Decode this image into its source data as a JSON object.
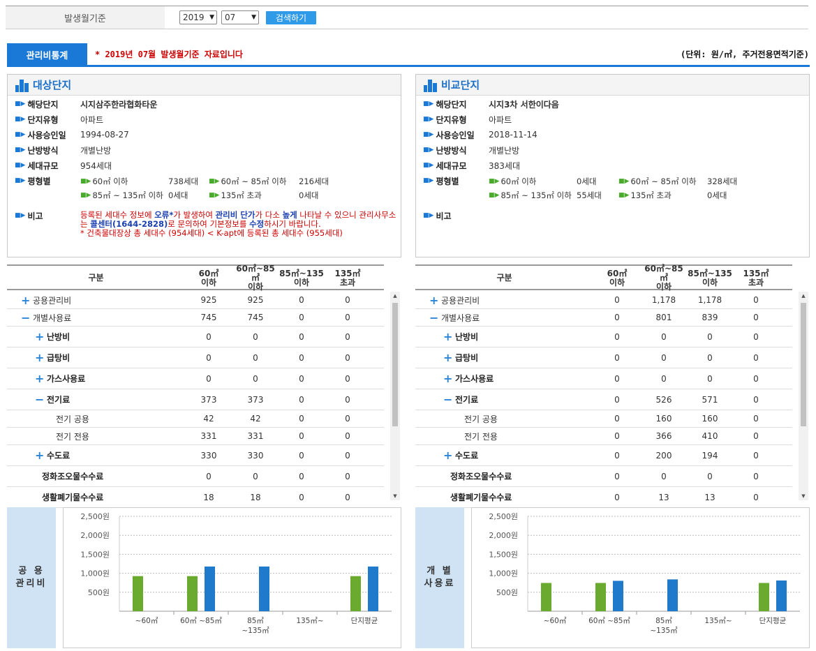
{
  "filter": {
    "label": "발생월기준",
    "year": "2019",
    "month": "07",
    "search_label": "검색하기"
  },
  "tab_label": "관리비통계",
  "notice": "* 2019년 07월 발생월기준 자료입니다",
  "unit_note": "(단위: 원/㎡, 주거전용면적기준)",
  "target": {
    "title": "대상단지",
    "labels": {
      "name": "해당단지",
      "type": "단지유형",
      "approval": "사용승인일",
      "heating": "난방방식",
      "scale": "세대규모",
      "size": "평형별",
      "remark": "비고"
    },
    "name": "시지삼주한라협화타운",
    "type": "아파트",
    "approval": "1994-08-27",
    "heating": "개별난방",
    "scale": "954세대",
    "sizes": [
      {
        "label": "60㎡ 이하",
        "count": "738세대"
      },
      {
        "label": "60㎡ ~ 85㎡ 이하",
        "count": "216세대"
      },
      {
        "label": "85㎡ ~ 135㎡ 이하",
        "count": "0세대"
      },
      {
        "label": "135㎡ 초과",
        "count": "0세대"
      }
    ],
    "remark": {
      "p1": "등록된 세대수 정보에 ",
      "p2": "오류*",
      "p3": "가 발생하여 ",
      "p4": "관리비 단가",
      "p5": "가 다소 ",
      "p6": "높게",
      "p7": " 나타날 수 있으니 관리사무소는 ",
      "p8": "콜센터(1644-2828)",
      "p9": "로 문의하여 기본정보를 ",
      "p10": "수정",
      "p11": "하시기 바랍니다.",
      "line2": "* 건축물대장상 총 세대수 (954세대) < K-apt에 등록된 총 세대수 (955세대)"
    }
  },
  "compare": {
    "title": "비교단지",
    "labels": {
      "name": "해당단지",
      "type": "단지유형",
      "approval": "사용승인일",
      "heating": "난방방식",
      "scale": "세대규모",
      "size": "평형별",
      "remark": "비고"
    },
    "name": "시지3차 서한이다음",
    "type": "아파트",
    "approval": "2018-11-14",
    "heating": "개별난방",
    "scale": "383세대",
    "sizes": [
      {
        "label": "60㎡ 이하",
        "count": "0세대"
      },
      {
        "label": "60㎡ ~ 85㎡ 이하",
        "count": "328세대"
      },
      {
        "label": "85㎡ ~ 135㎡ 이하",
        "count": "55세대"
      },
      {
        "label": "135㎡ 초과",
        "count": "0세대"
      }
    ]
  },
  "table_head": {
    "c0": "구분",
    "c1a": "60㎡",
    "c1b": "이하",
    "c2a": "60㎡~85㎡",
    "c2b": "이하",
    "c3a": "85㎡~135",
    "c3b": "이하",
    "c4a": "135㎡",
    "c4b": "초과"
  },
  "table_left": [
    {
      "label": "공용관리비",
      "icon": "plus",
      "v": [
        "925",
        "925",
        "0",
        "0"
      ]
    },
    {
      "label": "개별사용료",
      "icon": "minus",
      "v": [
        "745",
        "745",
        "0",
        "0"
      ]
    },
    {
      "label": "난방비",
      "icon": "plus",
      "v": [
        "0",
        "0",
        "0",
        "0"
      ]
    },
    {
      "label": "급탕비",
      "icon": "plus",
      "v": [
        "0",
        "0",
        "0",
        "0"
      ]
    },
    {
      "label": "가스사용료",
      "icon": "plus",
      "v": [
        "0",
        "0",
        "0",
        "0"
      ]
    },
    {
      "label": "전기료",
      "icon": "minus",
      "v": [
        "373",
        "373",
        "0",
        "0"
      ]
    },
    {
      "label": "전기 공용",
      "icon": "",
      "v": [
        "42",
        "42",
        "0",
        "0"
      ]
    },
    {
      "label": "전기 전용",
      "icon": "",
      "v": [
        "331",
        "331",
        "0",
        "0"
      ]
    },
    {
      "label": "수도료",
      "icon": "plus",
      "v": [
        "330",
        "330",
        "0",
        "0"
      ]
    },
    {
      "label": "정화조오물수수료",
      "icon": "",
      "v": [
        "0",
        "0",
        "0",
        "0"
      ]
    },
    {
      "label": "생활폐기물수수료",
      "icon": "",
      "v": [
        "18",
        "18",
        "0",
        "0"
      ]
    }
  ],
  "table_right": [
    {
      "label": "공용관리비",
      "icon": "plus",
      "v": [
        "0",
        "1,178",
        "1,178",
        "0"
      ]
    },
    {
      "label": "개별사용료",
      "icon": "minus",
      "v": [
        "0",
        "801",
        "839",
        "0"
      ]
    },
    {
      "label": "난방비",
      "icon": "plus",
      "v": [
        "0",
        "0",
        "0",
        "0"
      ]
    },
    {
      "label": "급탕비",
      "icon": "plus",
      "v": [
        "0",
        "0",
        "0",
        "0"
      ]
    },
    {
      "label": "가스사용료",
      "icon": "plus",
      "v": [
        "0",
        "0",
        "0",
        "0"
      ]
    },
    {
      "label": "전기료",
      "icon": "minus",
      "v": [
        "0",
        "526",
        "571",
        "0"
      ]
    },
    {
      "label": "전기 공용",
      "icon": "",
      "v": [
        "0",
        "160",
        "160",
        "0"
      ]
    },
    {
      "label": "전기 전용",
      "icon": "",
      "v": [
        "0",
        "366",
        "410",
        "0"
      ]
    },
    {
      "label": "수도료",
      "icon": "plus",
      "v": [
        "0",
        "200",
        "194",
        "0"
      ]
    },
    {
      "label": "정화조오물수수료",
      "icon": "",
      "v": [
        "0",
        "0",
        "0",
        "0"
      ]
    },
    {
      "label": "생활폐기물수수료",
      "icon": "",
      "v": [
        "0",
        "13",
        "13",
        "0"
      ]
    }
  ],
  "chart_side_left": [
    "공 용",
    "관리비"
  ],
  "chart_side_right": [
    "개 별",
    "사용료"
  ],
  "colors": {
    "target": "#6aaa2e",
    "compare": "#1f7acc",
    "accent": "#1a79d6"
  },
  "chart_data": [
    {
      "type": "bar",
      "categories": [
        "~60㎡",
        "60㎡ ~85㎡",
        "85㎡ ~135㎡",
        "135㎡~",
        "단지평균"
      ],
      "category_lines": [
        [
          "~60㎡"
        ],
        [
          "60㎡ ~85㎡"
        ],
        [
          "85㎡",
          "~135㎡"
        ],
        [
          "135㎡~"
        ],
        [
          "단지평균"
        ]
      ],
      "series": [
        {
          "values": [
            925,
            925,
            0,
            0,
            925
          ]
        },
        {
          "values": [
            0,
            1178,
            1178,
            0,
            1178
          ]
        }
      ],
      "yticks": [
        "2,500원",
        "2,000원",
        "1,500원",
        "1,000원",
        "500원"
      ],
      "ylim": [
        0,
        2500
      ]
    },
    {
      "type": "bar",
      "categories": [
        "~60㎡",
        "60㎡ ~85㎡",
        "85㎡ ~135㎡",
        "135㎡~",
        "단지평균"
      ],
      "category_lines": [
        [
          "~60㎡"
        ],
        [
          "60㎡ ~85㎡"
        ],
        [
          "85㎡",
          "~135㎡"
        ],
        [
          "135㎡~"
        ],
        [
          "단지평균"
        ]
      ],
      "series": [
        {
          "values": [
            745,
            745,
            0,
            0,
            745
          ]
        },
        {
          "values": [
            0,
            801,
            839,
            0,
            810
          ]
        }
      ],
      "yticks": [
        "2,500원",
        "2,000원",
        "1,500원",
        "1,000원",
        "500원"
      ],
      "ylim": [
        0,
        2500
      ]
    }
  ]
}
